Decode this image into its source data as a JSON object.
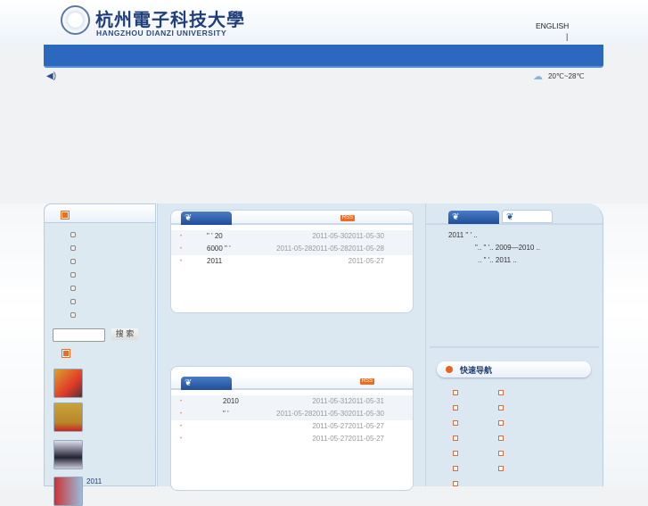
{
  "header": {
    "logo_cn": "杭州電子科技大學",
    "logo_en": "HANGZHOU DIANZI UNIVERSITY",
    "english_link": "ENGLISH",
    "separator": "|"
  },
  "weather": {
    "text": "20℃~28℃",
    "icon": "cloud-sun-icon"
  },
  "left": {
    "search_button": "搜 索",
    "search_value": "",
    "thumb_caption": "2011"
  },
  "news1": {
    "rss": "RSS",
    "rows": [
      {
        "title": "\" '   20",
        "date": "2011-05-302011-05-30",
        "extra": "\" '"
      },
      {
        "title": "6000   \" '",
        "date": "2011-05-282011-05-282011-05-28"
      },
      {
        "title": "2011",
        "date": "2011-05-27"
      }
    ]
  },
  "news2": {
    "rss": "RSS",
    "rows": [
      {
        "title": "2010",
        "date": "2011-05-312011-05-31"
      },
      {
        "title": "\" '",
        "date": "2011-05-282011-05-302011-05-30"
      },
      {
        "title": "",
        "date": "2011-05-272011-05-27"
      },
      {
        "title": "",
        "date": "2011-05-272011-05-27"
      }
    ]
  },
  "right": {
    "rows": [
      "2011 \" '                 ..",
      "\"..     \" '..   2009—2010  ..",
      "..  \"    '..  2011      .."
    ],
    "quick_nav": "快速导航"
  }
}
